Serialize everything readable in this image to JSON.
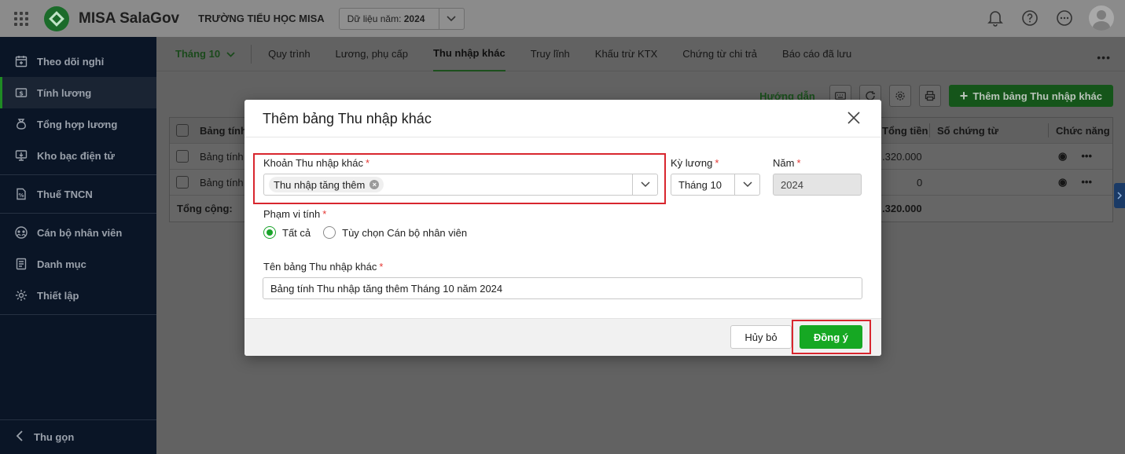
{
  "header": {
    "app_name": "MISA SalaGov",
    "school": "TRƯỜNG TIỂU HỌC MISA",
    "year_label": "Dữ liệu năm:",
    "year_value": "2024"
  },
  "sidebar": {
    "items": [
      {
        "label": "Theo dõi nghỉ"
      },
      {
        "label": "Tính lương"
      },
      {
        "label": "Tổng hợp lương"
      },
      {
        "label": "Kho bạc điện tử"
      },
      {
        "label": "Thuế TNCN"
      },
      {
        "label": "Cán bộ nhân viên"
      },
      {
        "label": "Danh mục"
      },
      {
        "label": "Thiết lập"
      }
    ],
    "collapse_label": "Thu gọn"
  },
  "tabs": {
    "month": "Tháng 10",
    "items": [
      "Quy trình",
      "Lương, phụ cấp",
      "Thu nhập khác",
      "Truy lĩnh",
      "Khấu trừ KTX",
      "Chứng từ chi trả",
      "Báo cáo đã lưu"
    ],
    "active_index": 2
  },
  "toolbar": {
    "guide": "Hướng dẫn",
    "add": "Thêm bảng Thu nhập khác"
  },
  "table": {
    "headers": {
      "name": "Bảng tính",
      "total": "Tổng tiền",
      "doc": "Số chứng từ",
      "fn": "Chức năng"
    },
    "rows": [
      {
        "name": "Bảng tính",
        "total": ".320.000"
      },
      {
        "name": "Bảng tính",
        "total": "0"
      }
    ],
    "footer_label": "Tổng cộng:",
    "footer_total": ".320.000"
  },
  "dialog": {
    "title": "Thêm bảng Thu nhập khác",
    "income_label": "Khoản Thu nhập khác",
    "income_chip": "Thu nhập tăng thêm",
    "period_label": "Kỳ lương",
    "period_value": "Tháng 10",
    "year_label": "Năm",
    "year_value": "2024",
    "scope_label": "Phạm vi tính",
    "scope_all": "Tất cả",
    "scope_custom": "Tùy chọn Cán bộ nhân viên",
    "name_label": "Tên bảng Thu nhập khác",
    "name_value": "Bảng tính Thu nhập tăng thêm Tháng 10 năm 2024",
    "cancel": "Hủy bỏ",
    "ok": "Đồng ý",
    "required_mark": "*"
  },
  "colors": {
    "accent": "#16a823",
    "highlight": "#d8262e",
    "sidebar": "#0a1526"
  }
}
